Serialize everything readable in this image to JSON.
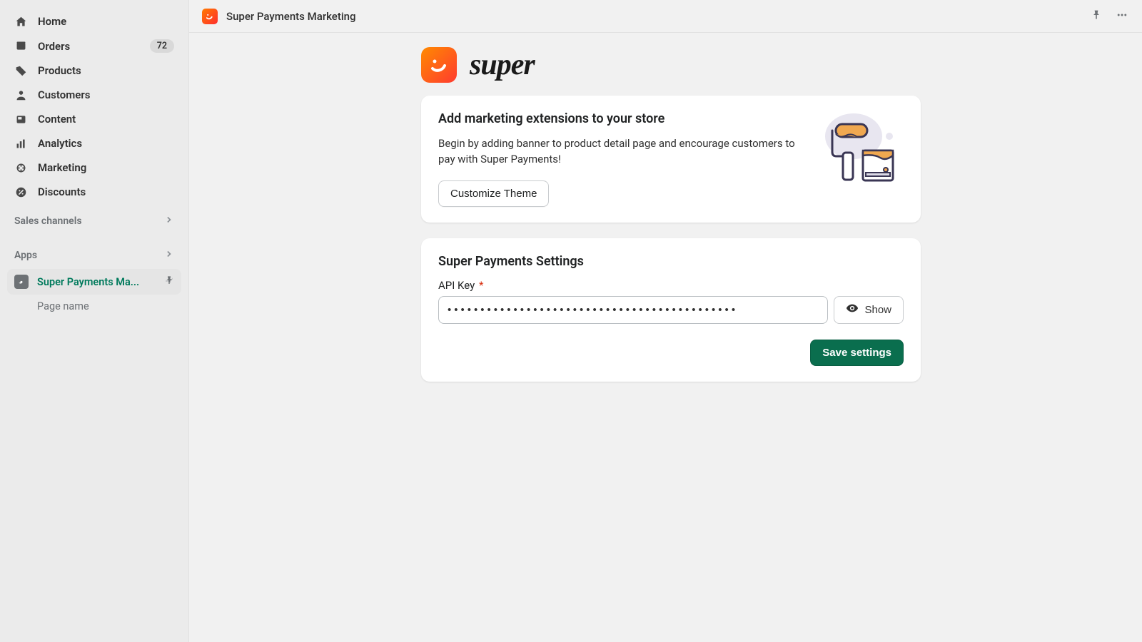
{
  "sidebar": {
    "items": [
      {
        "label": "Home"
      },
      {
        "label": "Orders",
        "badge": "72"
      },
      {
        "label": "Products"
      },
      {
        "label": "Customers"
      },
      {
        "label": "Content"
      },
      {
        "label": "Analytics"
      },
      {
        "label": "Marketing"
      },
      {
        "label": "Discounts"
      }
    ],
    "sections": {
      "sales_channels": "Sales channels",
      "apps": "Apps"
    },
    "active_app": "Super Payments Ma...",
    "sub_item": "Page name"
  },
  "topbar": {
    "title": "Super Payments Marketing"
  },
  "brand": {
    "word": "super"
  },
  "card_ext": {
    "title": "Add marketing extensions to your store",
    "body": "Begin by adding banner to product detail page and encourage customers to pay with Super Payments!",
    "button": "Customize Theme"
  },
  "card_settings": {
    "title": "Super Payments Settings",
    "api_label": "API Key",
    "api_required": "*",
    "api_value": "••••••••••••••••••••••••••••••••••••••••••••",
    "show_button": "Show",
    "save_button": "Save settings"
  },
  "colors": {
    "primary_green": "#0a6e4e",
    "brand_gradient_from": "#ff8a00",
    "brand_gradient_to": "#ff3b2f"
  }
}
